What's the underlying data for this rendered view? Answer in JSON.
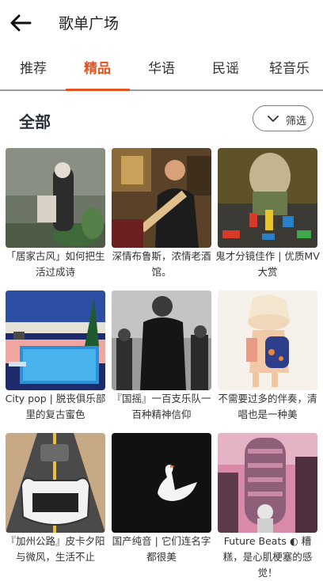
{
  "header": {
    "title": "歌单广场",
    "back_icon": "arrow-left-icon"
  },
  "tabs": [
    {
      "label": "推荐",
      "active": false
    },
    {
      "label": "精品",
      "active": true
    },
    {
      "label": "华语",
      "active": false
    },
    {
      "label": "民谣",
      "active": false
    },
    {
      "label": "轻音乐",
      "active": false
    }
  ],
  "section": {
    "title": "全部",
    "filter_label": "筛选",
    "filter_icon": "chevron-down-icon"
  },
  "playlists": [
    {
      "caption": "「居家古风」如何把生活过成诗"
    },
    {
      "caption": "深情布鲁斯，浓情老酒馆。"
    },
    {
      "caption": "鬼才分镜佳作 | 优质MV大赏"
    },
    {
      "caption": "City pop | 脱丧俱乐部里的复古蜜色"
    },
    {
      "caption": "『国摇』一百支乐队一百种精神信仰"
    },
    {
      "caption": "不需要过多的伴奏，清唱也是一种美"
    },
    {
      "caption": "『加州公路』皮卡夕阳与微风，生活不止"
    },
    {
      "caption": "国产纯音 | 它们连名字都很美"
    },
    {
      "caption": "Future Beats ◐ 糟糕，是心肌梗塞的感觉！"
    }
  ],
  "colors": {
    "accent": "#e8521f",
    "divider": "#9c9c9c"
  }
}
